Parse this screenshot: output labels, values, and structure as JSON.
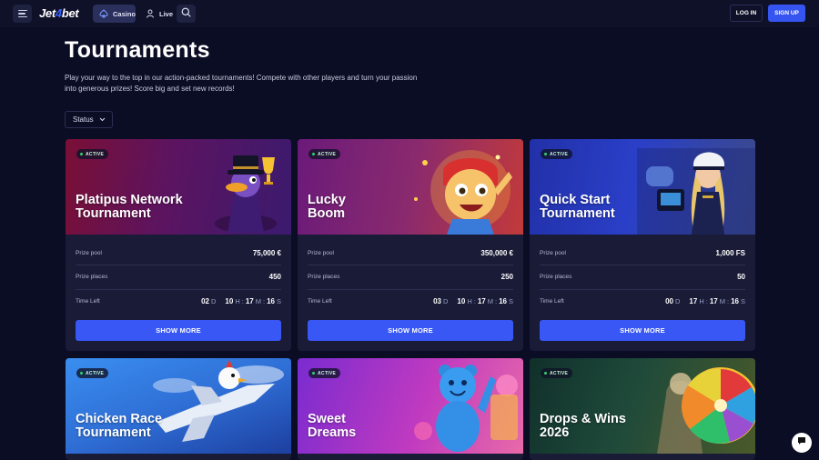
{
  "header": {
    "logo_text": "Jet",
    "logo_four": "4",
    "logo_rest": "bet",
    "tabs": [
      {
        "label": "Casino",
        "icon": "spade-icon"
      },
      {
        "label": "Live",
        "icon": "dealer-icon"
      }
    ],
    "login_label": "LOG IN",
    "signup_label": "SIGN UP"
  },
  "page": {
    "title": "Tournaments",
    "description": "Play your way to the top in our action-packed tournaments! Compete with other players and turn your passion into generous prizes! Score big and set new records!",
    "filter_label": "Status"
  },
  "labels": {
    "prize_pool": "Prize pool",
    "prize_places": "Prize places",
    "time_left": "Time Left",
    "show_more": "SHOW MORE",
    "active": "ACTIVE",
    "d": "D",
    "h": "H",
    "m": "M",
    "s": "S",
    "colon": ":"
  },
  "tournaments": [
    {
      "title_line1": "Platipus Network",
      "title_line2": "Tournament",
      "status": "ACTIVE",
      "prize_pool": "75,000 €",
      "prize_places": "450",
      "days": "02",
      "hours": "10",
      "minutes": "17",
      "seconds": "16"
    },
    {
      "title_line1": "Lucky",
      "title_line2": "Boom",
      "status": "ACTIVE",
      "prize_pool": "350,000 €",
      "prize_places": "250",
      "days": "03",
      "hours": "10",
      "minutes": "17",
      "seconds": "16"
    },
    {
      "title_line1": "Quick Start",
      "title_line2": "Tournament",
      "status": "ACTIVE",
      "prize_pool": "1,000 FS",
      "prize_places": "50",
      "days": "00",
      "hours": "17",
      "minutes": "17",
      "seconds": "16"
    },
    {
      "title_line1": "Chicken Race",
      "title_line2": "Tournament",
      "status": "ACTIVE"
    },
    {
      "title_line1": "Sweet",
      "title_line2": "Dreams",
      "status": "ACTIVE"
    },
    {
      "title_line1": "Drops & Wins",
      "title_line2": "2026",
      "status": "ACTIVE"
    }
  ],
  "colors": {
    "background": "#0b0d24",
    "card": "#191b37",
    "accent": "#3857f5",
    "active_dot": "#2fd46b"
  }
}
